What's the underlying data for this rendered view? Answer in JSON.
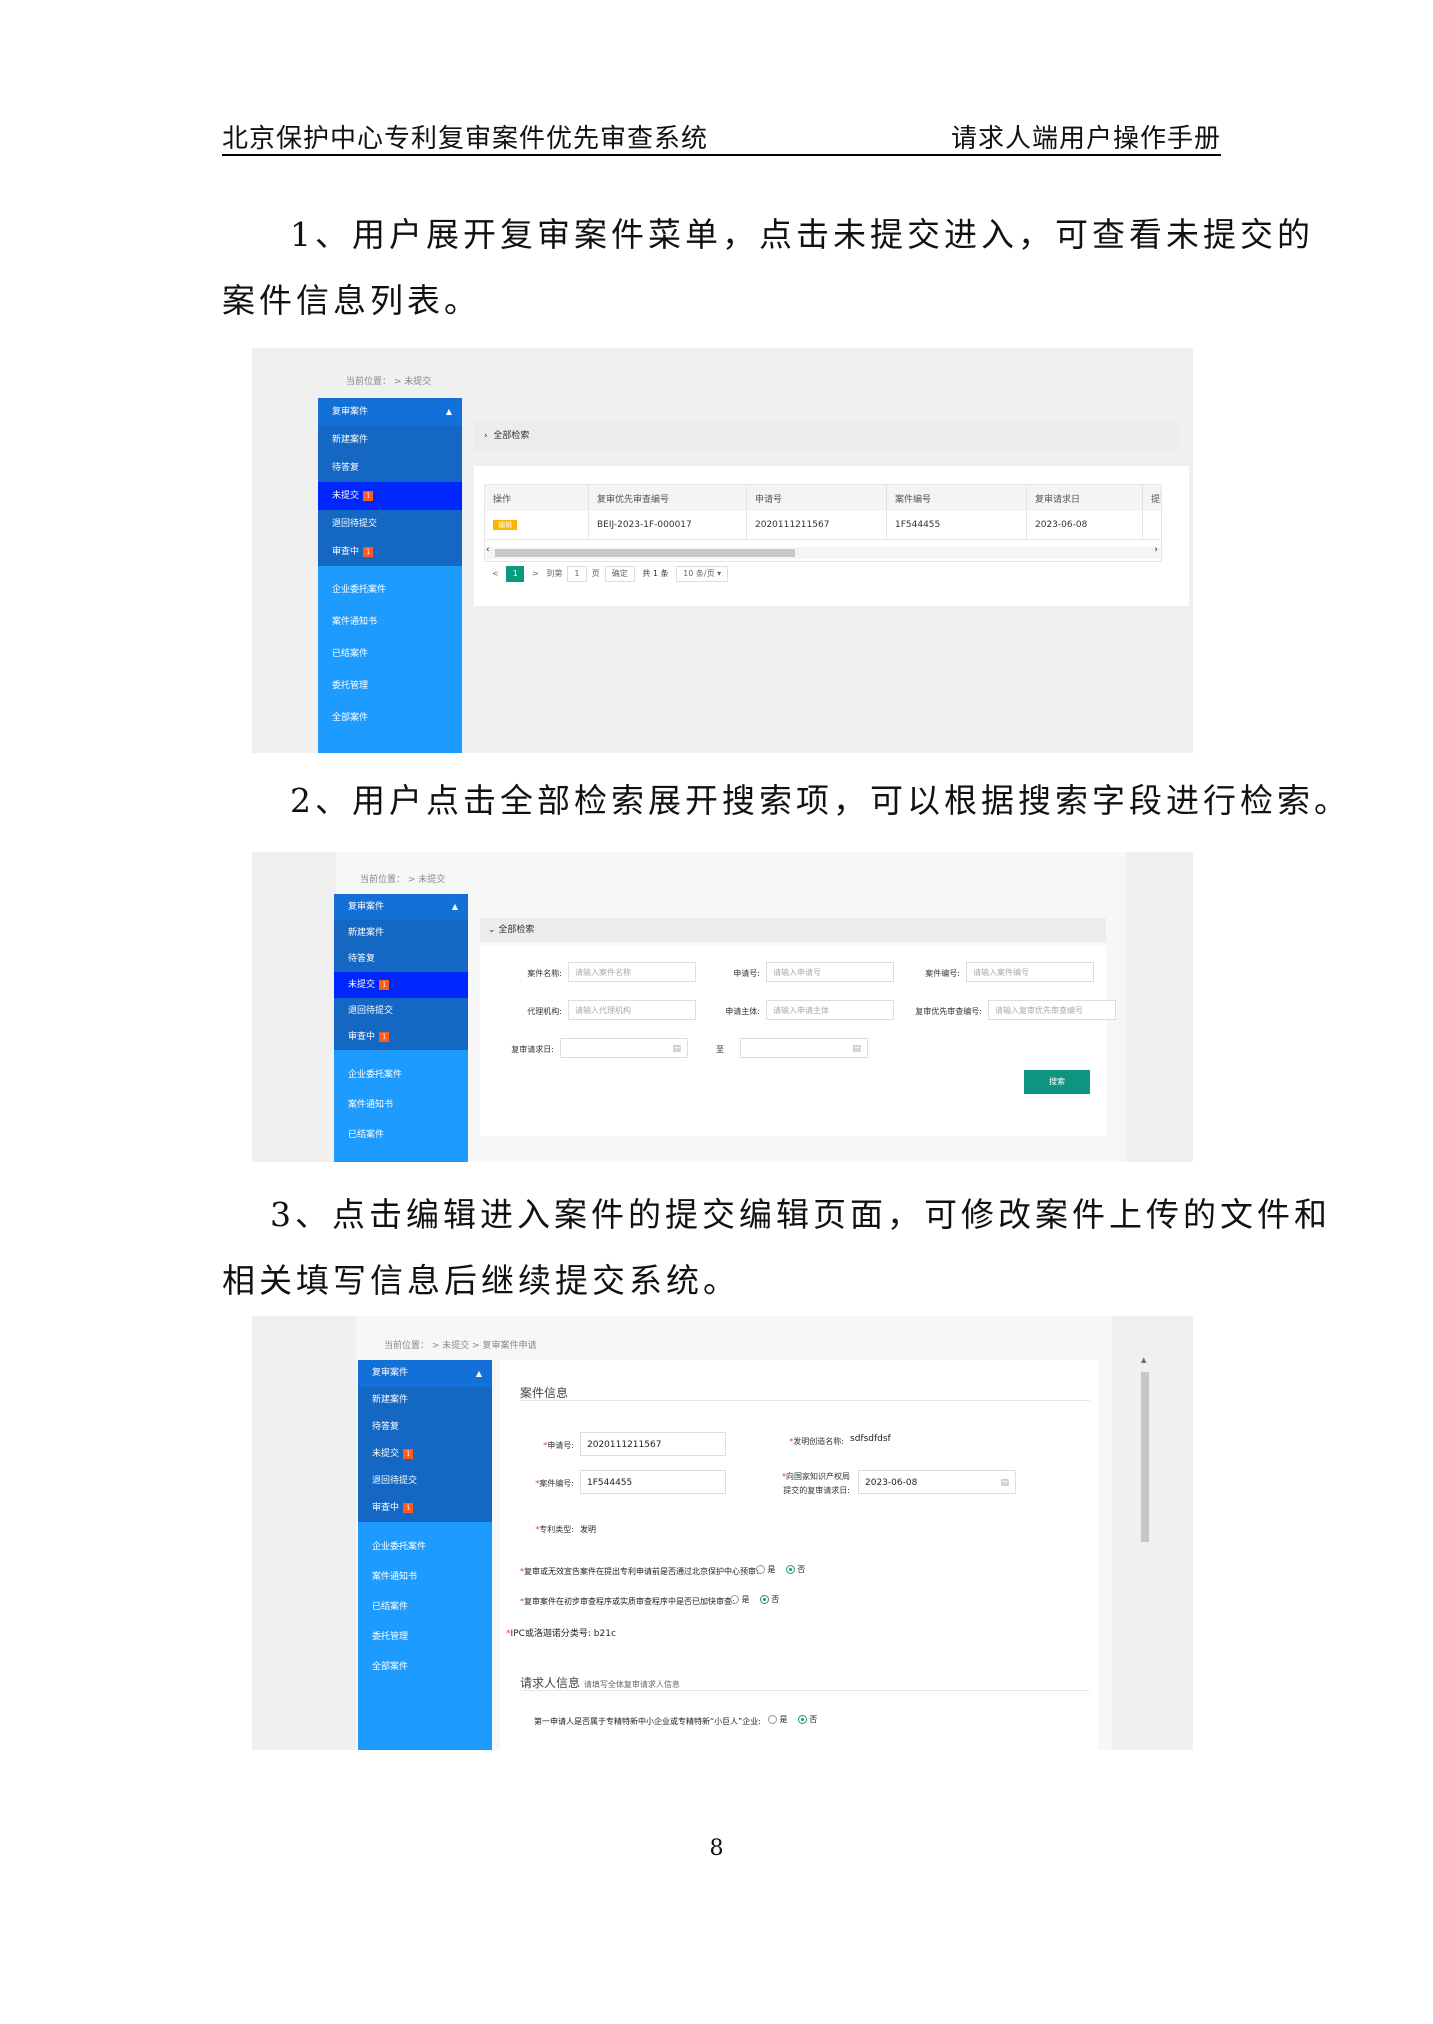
{
  "header": {
    "left": "北京保护中心专利复审案件优先审查系统",
    "right": "请求人端用户操作手册"
  },
  "paragraphs": [
    "1、用户展开复审案件菜单，点击未提交进入，可查看未提交的",
    "案件信息列表。",
    "2、用户点击全部检索展开搜索项，可以根据搜索字段进行检索。",
    "3、点击编辑进入案件的提交编辑页面，可修改案件上传的文件和",
    "相关填写信息后继续提交系统。"
  ],
  "sidebar": {
    "group_title": "复审案件",
    "items": [
      "新建案件",
      "待答复",
      "未提交",
      "退回待提交",
      "审查中"
    ],
    "badge": "1",
    "other": [
      "企业委托案件",
      "案件通知书",
      "已结案件",
      "委托管理",
      "全部案件"
    ]
  },
  "shot1": {
    "breadcrumb": "当前位置： >  未提交",
    "search_toggle": "全部检索",
    "columns": [
      "操作",
      "复审优先审查编号",
      "申请号",
      "案件编号",
      "复审请求日",
      "提交时"
    ],
    "row": {
      "action": "编辑",
      "priority_no": "BEIJ-2023-1F-000017",
      "app_no": "2020111211567",
      "case_no": "1F544455",
      "request_date": "2023-06-08"
    },
    "pager": {
      "prev": "<",
      "current": "1",
      "next": ">",
      "goto": "到第",
      "page_input": "1",
      "page_unit": "页",
      "confirm": "确定",
      "total": "共 1 条",
      "page_size": "10 条/页 ▾"
    }
  },
  "shot2": {
    "breadcrumb": "当前位置： >  未提交",
    "search_toggle": "全部检索",
    "fields": [
      {
        "label": "案件名称:",
        "placeholder": "请输入案件名称"
      },
      {
        "label": "申请号:",
        "placeholder": "请输入申请号"
      },
      {
        "label": "案件编号:",
        "placeholder": "请输入案件编号"
      },
      {
        "label": "代理机构:",
        "placeholder": "请输入代理机构"
      },
      {
        "label": "申请主体:",
        "placeholder": "请输入申请主体"
      },
      {
        "label": "复审优先审查编号:",
        "placeholder": "请输入复审优先审查编号"
      }
    ],
    "date_label": "复审请求日:",
    "date_sep": "至",
    "search_button": "搜索"
  },
  "shot3": {
    "breadcrumb": "当前位置： >  未提交  >  复审案件申请",
    "section1_title": "案件信息",
    "app_no_label": "申请号:",
    "app_no_value": "2020111211567",
    "invention_label": "发明创造名称:",
    "invention_value": "sdfsdfdsf",
    "case_no_label": "案件编号:",
    "case_no_value": "1F544455",
    "request_date_label_1": "向国家知识产权局",
    "request_date_label_2": "提交的复审请求日:",
    "request_date_value": "2023-06-08",
    "patent_type_label": "专利类型:",
    "patent_type_value": "发明",
    "q1": "复审或无效宣告案件在提出专利申请前是否通过北京保护中心预审:",
    "q2": "复审案件在初步审查程序或实质审查程序中是否已加快审查:",
    "ipc_label": "IPC或洛迦诺分类号:",
    "ipc_value": "b21c",
    "section2_title": "请求人信息",
    "section2_note": "请填写全体复审请求人信息",
    "q3": "第一申请人是否属于专精特新中小企业或专精特新“小巨人”企业:",
    "yes": "是",
    "no": "否"
  },
  "page_number": "8"
}
